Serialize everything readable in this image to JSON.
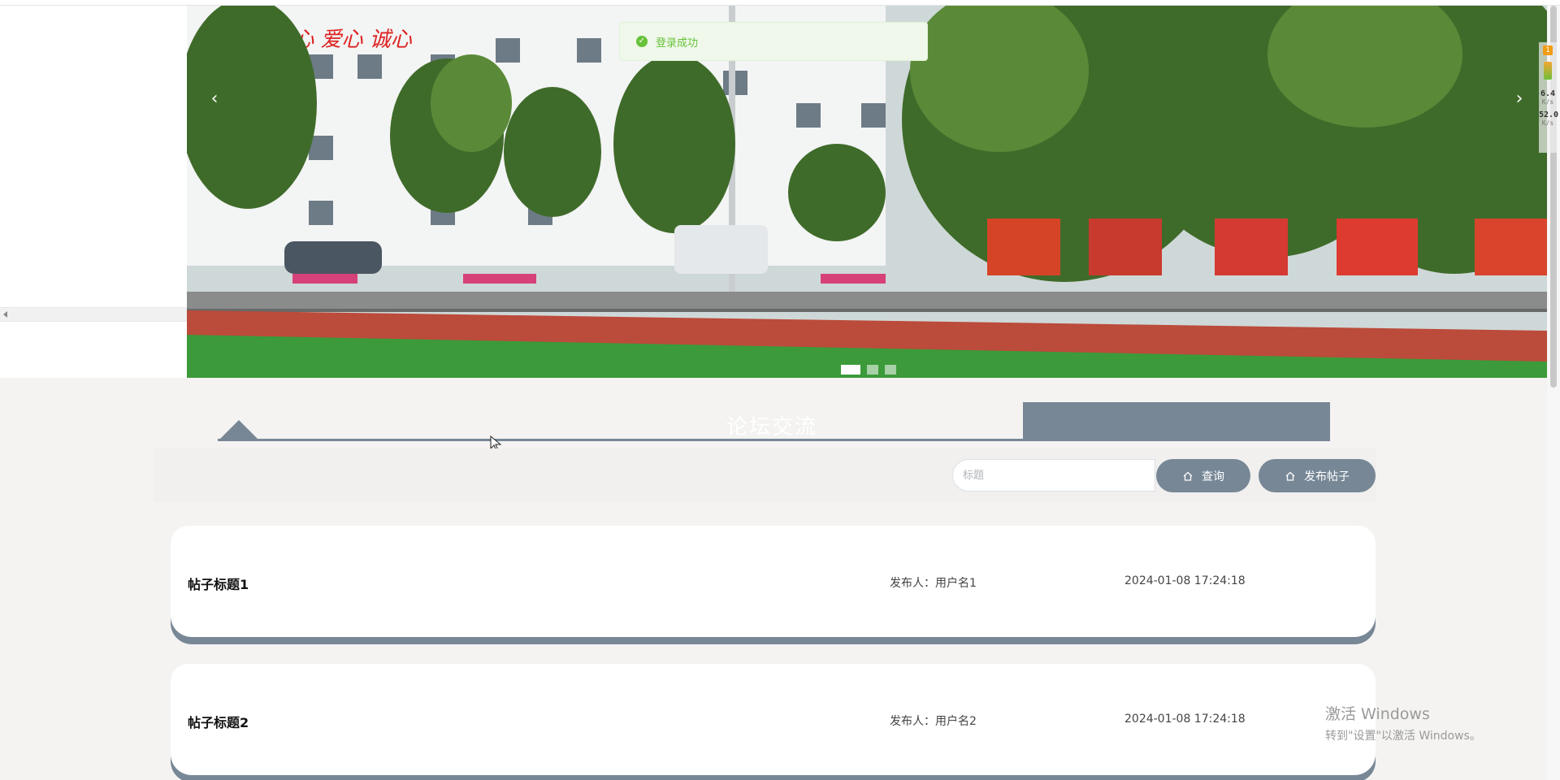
{
  "toast": {
    "message": "登录成功"
  },
  "carousel": {
    "prev_label": "‹",
    "next_label": "›",
    "slides": 3,
    "active_slide": 1,
    "banner_text": "心 专心 爱心 诚心"
  },
  "section": {
    "title": "论坛交流"
  },
  "search": {
    "placeholder": "标题",
    "value": "",
    "search_label": "查询",
    "publish_label": "发布帖子"
  },
  "posts": [
    {
      "title": "帖子标题1",
      "author": "发布人：用户名1",
      "time": "2024-01-08 17:24:18"
    },
    {
      "title": "帖子标题2",
      "author": "发布人：用户名2",
      "time": "2024-01-08 17:24:18"
    }
  ],
  "system_widget": {
    "badge": "1",
    "value1": "6.4",
    "unit1": "K/s",
    "value2": "52.0",
    "unit2": "K/s"
  },
  "watermark": {
    "line1": "激活 Windows",
    "line2": "转到\"设置\"以激活 Windows。"
  },
  "colors": {
    "accent": "#778796",
    "success": "#67c23a",
    "background": "#f4f3f2"
  }
}
